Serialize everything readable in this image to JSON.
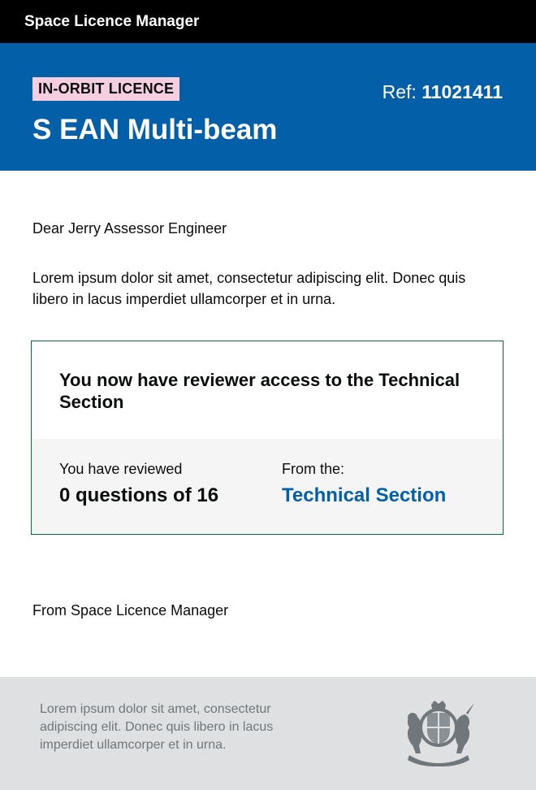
{
  "app": {
    "name": "Space Licence Manager"
  },
  "header": {
    "tag": "IN-ORBIT LICENCE",
    "ref_label": "Ref:",
    "ref_number": "11021411",
    "title": "S EAN Multi-beam"
  },
  "message": {
    "greeting": "Dear Jerry Assessor Engineer",
    "body": "Lorem ipsum dolor sit amet, consectetur adipiscing elit. Donec quis libero in lacus imperdiet ullamcorper et in urna."
  },
  "panel": {
    "heading": "You now have reviewer access to the Technical Section",
    "reviewed_label": "You have reviewed",
    "reviewed_value": "0 questions of 16",
    "from_label": "From the:",
    "from_link": "Technical Section"
  },
  "signoff": "From Space Licence Manager",
  "footer": {
    "text": "Lorem ipsum dolor sit amet, consectetur adipiscing elit. Donec quis libero in lacus imperdiet ullamcorper et in urna.",
    "crest_icon": "royal-coat-of-arms-icon"
  },
  "colors": {
    "header_blue": "#0360a8",
    "tag_pink": "#f5cedf",
    "panel_border_green": "#00703c",
    "footer_grey": "#dfe0e1"
  }
}
